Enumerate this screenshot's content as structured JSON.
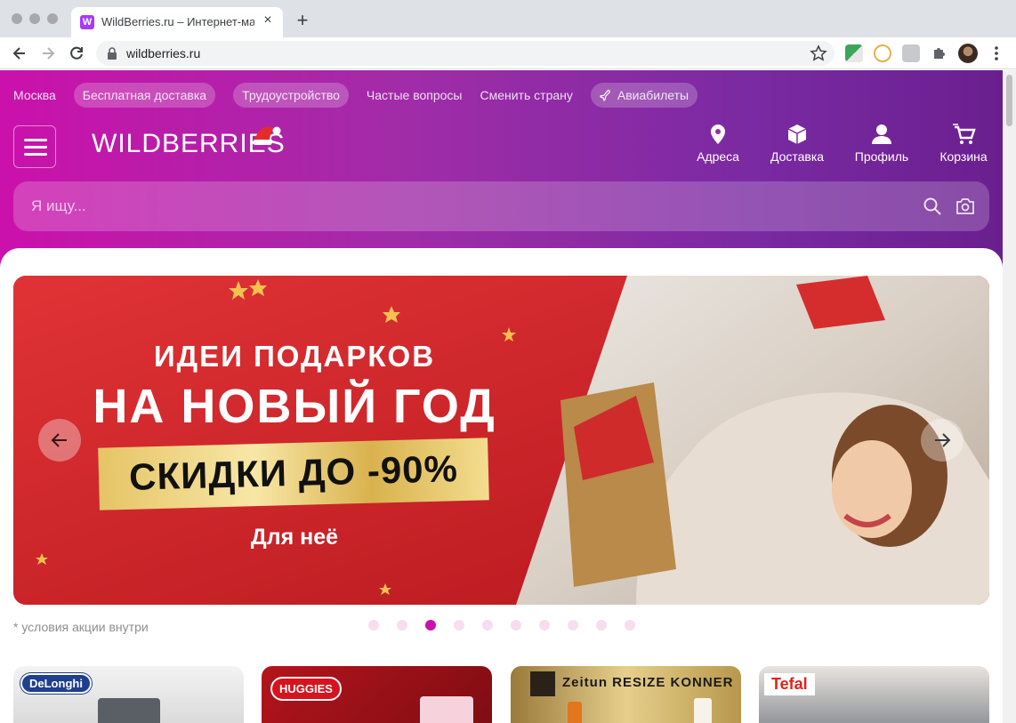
{
  "browser": {
    "tab_title": "WildBerries.ru – Интернет-магазин",
    "tab_favicon": "W",
    "url": "wildberries.ru"
  },
  "colors": {
    "brand": "#cb11ab",
    "brand_dark": "#6a1f8f",
    "banner_red": "#d12a2c"
  },
  "topnav": {
    "city": "Москва",
    "free_delivery": "Бесплатная доставка",
    "jobs": "Трудоустройство",
    "faq": "Частые вопросы",
    "change_country": "Сменить страну",
    "flights": "Авиабилеты"
  },
  "header": {
    "logo": "WILDBERRIES",
    "actions": {
      "addresses": "Адреса",
      "delivery": "Доставка",
      "profile": "Профиль",
      "cart": "Корзина"
    }
  },
  "search": {
    "placeholder": "Я ищу..."
  },
  "banner": {
    "line1": "ИДЕИ ПОДАРКОВ",
    "line2": "НА НОВЫЙ ГОД",
    "line3": "СКИДКИ ДО -90%",
    "line4": "Для неё",
    "total_slides": 10,
    "active_slide": 3
  },
  "terms_note": "* условия акции внутри",
  "brand_tiles": [
    "DeLonghi",
    "HUGGIES",
    "Zeitun RESIZE KONNER",
    "Tefal"
  ]
}
